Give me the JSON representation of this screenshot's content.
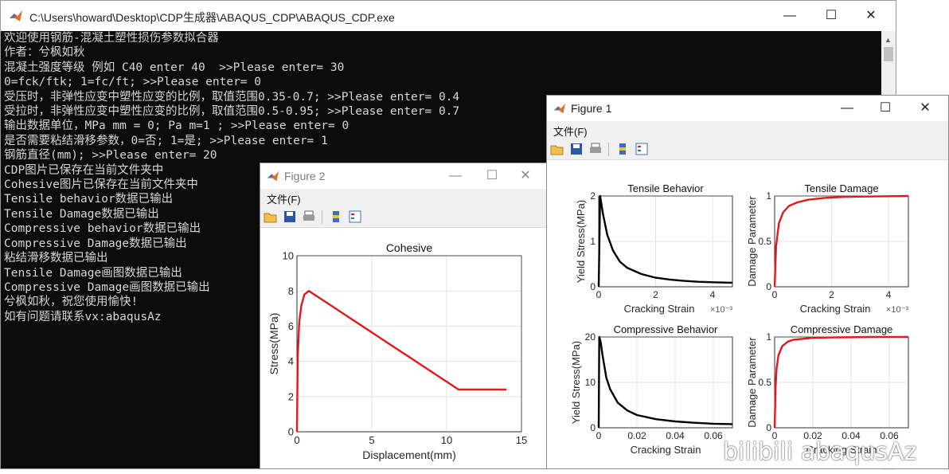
{
  "console": {
    "title": "C:\\Users\\howard\\Desktop\\CDP生成器\\ABAQUS_CDP\\ABAQUS_CDP.exe",
    "lines": [
      "欢迎使用钢筋-混凝土塑性损伤参数拟合器",
      "作者：兮枫如秋",
      "混凝土强度等级 例如 C40 enter 40  >>Please enter= 30",
      "0=fck/ftk; 1=fc/ft; >>Please enter= 0",
      "受压时，非弹性应变中塑性应变的比例，取值范围0.35-0.7; >>Please enter= 0.4",
      "受拉时，非弹性应变中塑性应变的比例，取值范围0.5-0.95; >>Please enter= 0.7",
      "输出数据单位，MPa mm = 0; Pa m=1 ; >>Please enter= 0",
      "是否需要粘结滑移参数，0=否; 1=是; >>Please enter= 1",
      "钢筋直径(mm); >>Please enter= 20",
      "CDP图片已保存在当前文件夹中",
      "Cohesive图片已保存在当前文件夹中",
      "Tensile behavior数据已输出",
      "Tensile Damage数据已输出",
      "Compressive behavior数据已输出",
      "Compressive Damage数据已输出",
      "粘结滑移数据已输出",
      "Tensile Damage画图数据已输出",
      "Compressive Damage画图数据已输出",
      "兮枫如秋，祝您使用愉快!",
      "如有问题请联系vx:abaqusAz"
    ]
  },
  "window_buttons": {
    "minimize": "—",
    "maximize": "☐",
    "close": "✕"
  },
  "figure2": {
    "title": "Figure 2",
    "menu": "文件(F)",
    "plot": {
      "title": "Cohesive",
      "xlabel": "Displacement(mm)",
      "ylabel": "Stress(MPa)",
      "xticks": [
        "0",
        "5",
        "10",
        "15"
      ],
      "yticks": [
        "0",
        "2",
        "4",
        "6",
        "8",
        "10"
      ]
    }
  },
  "figure1": {
    "title": "Figure 1",
    "menu": "文件(F)",
    "plots": {
      "tb": {
        "title": "Tensile Behavior",
        "xlabel": "Cracking Strain",
        "exp": "×10⁻³",
        "ylabel": "Yield Stress(MPa)",
        "xticks": [
          "0",
          "2",
          "4"
        ],
        "yticks": [
          "0",
          "1",
          "2"
        ]
      },
      "td": {
        "title": "Tensile Damage",
        "xlabel": "Cracking Strain",
        "exp": "×10⁻³",
        "ylabel": "Damage Parameter",
        "xticks": [
          "0",
          "2",
          "4"
        ],
        "yticks": [
          "0",
          "0.5",
          "1"
        ]
      },
      "cb": {
        "title": "Compressive Behavior",
        "xlabel": "Cracking Strain",
        "ylabel": "Yield Stress(MPa)",
        "xticks": [
          "0",
          "0.02",
          "0.04",
          "0.06"
        ],
        "yticks": [
          "0",
          "10",
          "20"
        ]
      },
      "cd": {
        "title": "Compressive Damage",
        "xlabel": "Cracking Strain",
        "ylabel": "Damage Parameter",
        "xticks": [
          "0",
          "0.02",
          "0.04",
          "0.06"
        ],
        "yticks": [
          "0",
          "0.5",
          "1"
        ]
      }
    }
  },
  "chart_data": [
    {
      "type": "line",
      "title": "Cohesive",
      "xlabel": "Displacement(mm)",
      "ylabel": "Stress(MPa)",
      "xlim": [
        0,
        15
      ],
      "ylim": [
        0,
        10
      ],
      "grid": true,
      "color": "#e0191b",
      "x": [
        0,
        0.05,
        0.15,
        0.3,
        0.5,
        0.8,
        10.8,
        14
      ],
      "y": [
        0,
        4.2,
        6.2,
        7.2,
        7.8,
        8.0,
        2.4,
        2.4
      ]
    },
    {
      "type": "line",
      "title": "Tensile Behavior",
      "xlabel": "Cracking Strain",
      "ylabel": "Yield Stress(MPa)",
      "x_multiplier": "×10⁻³",
      "xlim": [
        0,
        4.7
      ],
      "ylim": [
        0,
        2
      ],
      "grid": true,
      "color": "#000000",
      "x": [
        0,
        0.05,
        0.15,
        0.3,
        0.5,
        0.75,
        1.0,
        1.5,
        2.0,
        2.5,
        3.0,
        3.5,
        4.0,
        4.7
      ],
      "y": [
        0,
        2.0,
        1.6,
        1.15,
        0.8,
        0.55,
        0.42,
        0.28,
        0.2,
        0.16,
        0.13,
        0.11,
        0.1,
        0.09
      ]
    },
    {
      "type": "line",
      "title": "Tensile Damage",
      "xlabel": "Cracking Strain",
      "ylabel": "Damage Parameter",
      "x_multiplier": "×10⁻³",
      "xlim": [
        0,
        4.7
      ],
      "ylim": [
        0,
        1
      ],
      "grid": true,
      "color": "#e0191b",
      "x": [
        0,
        0.05,
        0.15,
        0.3,
        0.5,
        0.8,
        1.2,
        1.8,
        2.5,
        3.5,
        4.7
      ],
      "y": [
        0,
        0.45,
        0.7,
        0.82,
        0.89,
        0.93,
        0.96,
        0.98,
        0.99,
        0.995,
        1.0
      ]
    },
    {
      "type": "line",
      "title": "Compressive Behavior",
      "xlabel": "Cracking Strain",
      "ylabel": "Yield Stress(MPa)",
      "xlim": [
        0,
        0.07
      ],
      "ylim": [
        0,
        20
      ],
      "grid": true,
      "color": "#000000",
      "x": [
        0,
        0.0003,
        0.001,
        0.002,
        0.004,
        0.006,
        0.01,
        0.015,
        0.02,
        0.03,
        0.04,
        0.05,
        0.06,
        0.07
      ],
      "y": [
        0,
        20,
        19,
        16,
        11,
        8.5,
        5.5,
        3.8,
        2.8,
        1.9,
        1.4,
        1.1,
        0.9,
        0.8
      ]
    },
    {
      "type": "line",
      "title": "Compressive Damage",
      "xlabel": "Cracking Strain",
      "ylabel": "Damage Parameter",
      "xlim": [
        0,
        0.07
      ],
      "ylim": [
        0,
        1
      ],
      "grid": true,
      "color": "#e0191b",
      "x": [
        0,
        0.0005,
        0.001,
        0.002,
        0.004,
        0.007,
        0.01,
        0.02,
        0.03,
        0.05,
        0.07
      ],
      "y": [
        0,
        0.45,
        0.65,
        0.8,
        0.9,
        0.95,
        0.97,
        0.99,
        0.995,
        1.0,
        1.0
      ]
    }
  ],
  "watermark": "bilibili abaqusAz"
}
